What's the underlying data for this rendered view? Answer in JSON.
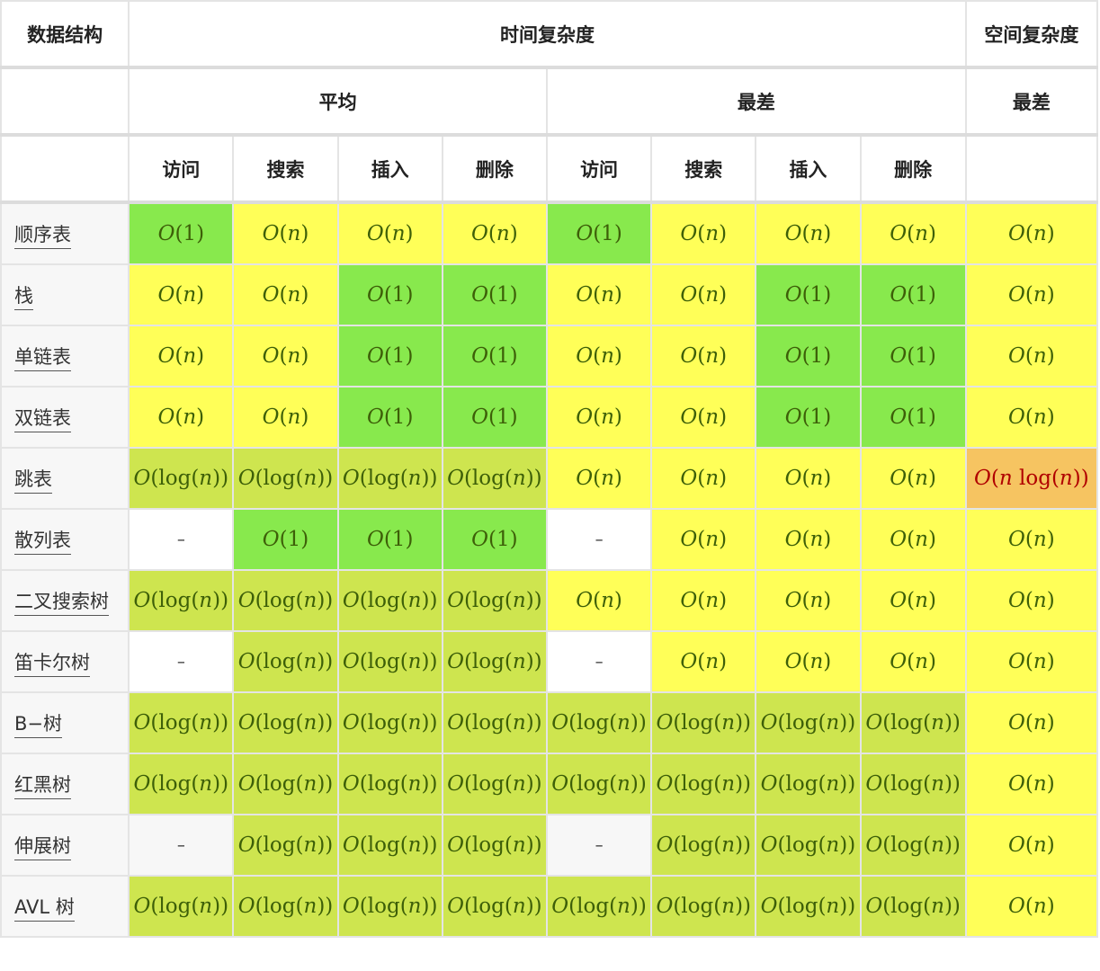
{
  "headers": {
    "structure": "数据结构",
    "time": "时间复杂度",
    "space": "空间复杂度",
    "average": "平均",
    "worst": "最差",
    "space_worst": "最差",
    "ops": [
      "访问",
      "搜索",
      "插入",
      "删除",
      "访问",
      "搜索",
      "插入",
      "删除"
    ]
  },
  "colors": {
    "green": "#88e94d",
    "lime": "#cee54f",
    "yellow": "#ffff58",
    "orange": "#f6c461",
    "none": "#ffffff",
    "grey": "#f7f7f7"
  },
  "rows": [
    {
      "name": "顺序表",
      "cells": [
        [
          "O(1)",
          "green"
        ],
        [
          "O(n)",
          "yellow"
        ],
        [
          "O(n)",
          "yellow"
        ],
        [
          "O(n)",
          "yellow"
        ],
        [
          "O(1)",
          "green"
        ],
        [
          "O(n)",
          "yellow"
        ],
        [
          "O(n)",
          "yellow"
        ],
        [
          "O(n)",
          "yellow"
        ],
        [
          "O(n)",
          "yellow"
        ]
      ]
    },
    {
      "name": "栈",
      "cells": [
        [
          "O(n)",
          "yellow"
        ],
        [
          "O(n)",
          "yellow"
        ],
        [
          "O(1)",
          "green"
        ],
        [
          "O(1)",
          "green"
        ],
        [
          "O(n)",
          "yellow"
        ],
        [
          "O(n)",
          "yellow"
        ],
        [
          "O(1)",
          "green"
        ],
        [
          "O(1)",
          "green"
        ],
        [
          "O(n)",
          "yellow"
        ]
      ]
    },
    {
      "name": "单链表",
      "cells": [
        [
          "O(n)",
          "yellow"
        ],
        [
          "O(n)",
          "yellow"
        ],
        [
          "O(1)",
          "green"
        ],
        [
          "O(1)",
          "green"
        ],
        [
          "O(n)",
          "yellow"
        ],
        [
          "O(n)",
          "yellow"
        ],
        [
          "O(1)",
          "green"
        ],
        [
          "O(1)",
          "green"
        ],
        [
          "O(n)",
          "yellow"
        ]
      ]
    },
    {
      "name": "双链表",
      "cells": [
        [
          "O(n)",
          "yellow"
        ],
        [
          "O(n)",
          "yellow"
        ],
        [
          "O(1)",
          "green"
        ],
        [
          "O(1)",
          "green"
        ],
        [
          "O(n)",
          "yellow"
        ],
        [
          "O(n)",
          "yellow"
        ],
        [
          "O(1)",
          "green"
        ],
        [
          "O(1)",
          "green"
        ],
        [
          "O(n)",
          "yellow"
        ]
      ]
    },
    {
      "name": "跳表",
      "cells": [
        [
          "O(log(n))",
          "lime"
        ],
        [
          "O(log(n))",
          "lime"
        ],
        [
          "O(log(n))",
          "lime"
        ],
        [
          "O(log(n))",
          "lime"
        ],
        [
          "O(n)",
          "yellow"
        ],
        [
          "O(n)",
          "yellow"
        ],
        [
          "O(n)",
          "yellow"
        ],
        [
          "O(n)",
          "yellow"
        ],
        [
          "O(n log(n))",
          "orange"
        ]
      ]
    },
    {
      "name": "散列表",
      "cells": [
        [
          "–",
          "none"
        ],
        [
          "O(1)",
          "green"
        ],
        [
          "O(1)",
          "green"
        ],
        [
          "O(1)",
          "green"
        ],
        [
          "–",
          "none"
        ],
        [
          "O(n)",
          "yellow"
        ],
        [
          "O(n)",
          "yellow"
        ],
        [
          "O(n)",
          "yellow"
        ],
        [
          "O(n)",
          "yellow"
        ]
      ]
    },
    {
      "name": "二叉搜索树",
      "cells": [
        [
          "O(log(n))",
          "lime"
        ],
        [
          "O(log(n))",
          "lime"
        ],
        [
          "O(log(n))",
          "lime"
        ],
        [
          "O(log(n))",
          "lime"
        ],
        [
          "O(n)",
          "yellow"
        ],
        [
          "O(n)",
          "yellow"
        ],
        [
          "O(n)",
          "yellow"
        ],
        [
          "O(n)",
          "yellow"
        ],
        [
          "O(n)",
          "yellow"
        ]
      ]
    },
    {
      "name": "笛卡尔树",
      "cells": [
        [
          "–",
          "none"
        ],
        [
          "O(log(n))",
          "lime"
        ],
        [
          "O(log(n))",
          "lime"
        ],
        [
          "O(log(n))",
          "lime"
        ],
        [
          "–",
          "none"
        ],
        [
          "O(n)",
          "yellow"
        ],
        [
          "O(n)",
          "yellow"
        ],
        [
          "O(n)",
          "yellow"
        ],
        [
          "O(n)",
          "yellow"
        ]
      ]
    },
    {
      "name": "B−树",
      "cells": [
        [
          "O(log(n))",
          "lime"
        ],
        [
          "O(log(n))",
          "lime"
        ],
        [
          "O(log(n))",
          "lime"
        ],
        [
          "O(log(n))",
          "lime"
        ],
        [
          "O(log(n))",
          "lime"
        ],
        [
          "O(log(n))",
          "lime"
        ],
        [
          "O(log(n))",
          "lime"
        ],
        [
          "O(log(n))",
          "lime"
        ],
        [
          "O(n)",
          "yellow"
        ]
      ]
    },
    {
      "name": "红黑树",
      "cells": [
        [
          "O(log(n))",
          "lime"
        ],
        [
          "O(log(n))",
          "lime"
        ],
        [
          "O(log(n))",
          "lime"
        ],
        [
          "O(log(n))",
          "lime"
        ],
        [
          "O(log(n))",
          "lime"
        ],
        [
          "O(log(n))",
          "lime"
        ],
        [
          "O(log(n))",
          "lime"
        ],
        [
          "O(log(n))",
          "lime"
        ],
        [
          "O(n)",
          "yellow"
        ]
      ]
    },
    {
      "name": "伸展树",
      "cells": [
        [
          "–",
          "grey"
        ],
        [
          "O(log(n))",
          "lime"
        ],
        [
          "O(log(n))",
          "lime"
        ],
        [
          "O(log(n))",
          "lime"
        ],
        [
          "–",
          "grey"
        ],
        [
          "O(log(n))",
          "lime"
        ],
        [
          "O(log(n))",
          "lime"
        ],
        [
          "O(log(n))",
          "lime"
        ],
        [
          "O(n)",
          "yellow"
        ]
      ]
    },
    {
      "name": "AVL 树",
      "cells": [
        [
          "O(log(n))",
          "lime"
        ],
        [
          "O(log(n))",
          "lime"
        ],
        [
          "O(log(n))",
          "lime"
        ],
        [
          "O(log(n))",
          "lime"
        ],
        [
          "O(log(n))",
          "lime"
        ],
        [
          "O(log(n))",
          "lime"
        ],
        [
          "O(log(n))",
          "lime"
        ],
        [
          "O(log(n))",
          "lime"
        ],
        [
          "O(n)",
          "yellow"
        ]
      ]
    }
  ]
}
